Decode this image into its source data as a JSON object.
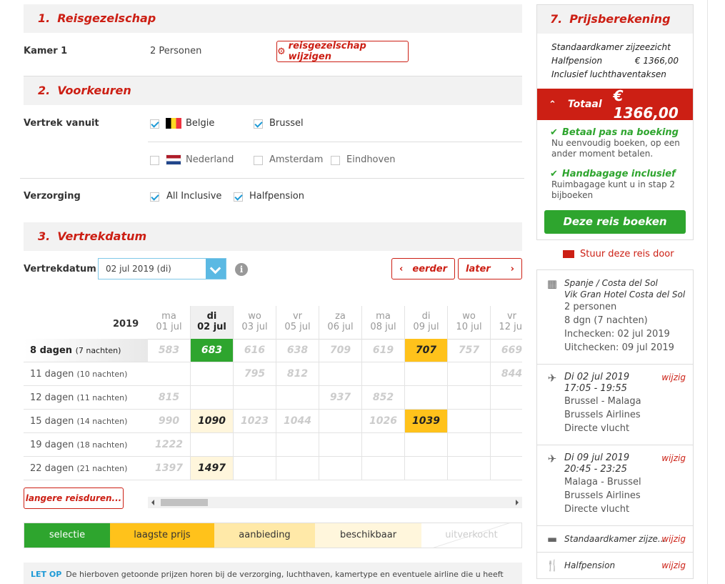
{
  "section1": {
    "num": "1.",
    "title": "Reisgezelschap",
    "kamer_label": "Kamer 1",
    "personen": "2 Personen",
    "wijzigen_button": "reisgezelschap wijzigen"
  },
  "section2": {
    "num": "2.",
    "title": "Voorkeuren",
    "vertrek_label": "Vertrek vanuit",
    "countries": [
      {
        "name": "Belgie",
        "checked": true
      },
      {
        "name": "Nederland",
        "checked": false
      }
    ],
    "airports": [
      {
        "name": "Brussel",
        "checked": true
      },
      {
        "name": "Amsterdam",
        "checked": false
      },
      {
        "name": "Eindhoven",
        "checked": false
      }
    ],
    "verzorging_label": "Verzorging",
    "verzorging": [
      {
        "name": "All Inclusive",
        "checked": true
      },
      {
        "name": "Halfpension",
        "checked": true
      }
    ]
  },
  "section3": {
    "num": "3.",
    "title": "Vertrekdatum",
    "date_label": "Vertrekdatum",
    "selected_date": "02 jul 2019 (di)",
    "earlier_button": "eerder",
    "later_button": "later",
    "year": "2019",
    "columns": [
      {
        "day": "ma",
        "date": "01 jul"
      },
      {
        "day": "di",
        "date": "02 jul",
        "active": true
      },
      {
        "day": "wo",
        "date": "03 jul"
      },
      {
        "day": "vr",
        "date": "05 jul"
      },
      {
        "day": "za",
        "date": "06 jul"
      },
      {
        "day": "ma",
        "date": "08 jul"
      },
      {
        "day": "di",
        "date": "09 jul"
      },
      {
        "day": "wo",
        "date": "10 jul"
      },
      {
        "day": "vr",
        "date": "12 jul"
      }
    ],
    "rows": [
      {
        "label": "8 dagen",
        "nights": "(7 nachten)",
        "active": true,
        "cells": [
          [
            "583",
            ""
          ],
          [
            "683",
            "sel"
          ],
          [
            "616",
            ""
          ],
          [
            "638",
            ""
          ],
          [
            "709",
            ""
          ],
          [
            "619",
            ""
          ],
          [
            "707",
            "low"
          ],
          [
            "757",
            ""
          ],
          [
            "669",
            ""
          ]
        ]
      },
      {
        "label": "11 dagen",
        "nights": "(10 nachten)",
        "cells": [
          [
            "",
            ""
          ],
          [
            "",
            ""
          ],
          [
            "795",
            ""
          ],
          [
            "812",
            ""
          ],
          [
            "",
            ""
          ],
          [
            "",
            ""
          ],
          [
            "",
            ""
          ],
          [
            "",
            ""
          ],
          [
            "844",
            ""
          ]
        ]
      },
      {
        "label": "12 dagen",
        "nights": "(11 nachten)",
        "cells": [
          [
            "815",
            ""
          ],
          [
            "",
            ""
          ],
          [
            "",
            ""
          ],
          [
            "",
            ""
          ],
          [
            "937",
            ""
          ],
          [
            "852",
            ""
          ],
          [
            "",
            ""
          ],
          [
            "",
            ""
          ],
          [
            "",
            ""
          ]
        ]
      },
      {
        "label": "15 dagen",
        "nights": "(14 nachten)",
        "cells": [
          [
            "990",
            ""
          ],
          [
            "1090",
            "avail"
          ],
          [
            "1023",
            ""
          ],
          [
            "1044",
            ""
          ],
          [
            "",
            ""
          ],
          [
            "1026",
            ""
          ],
          [
            "1039",
            "low"
          ],
          [
            "",
            ""
          ],
          [
            "",
            ""
          ]
        ]
      },
      {
        "label": "19 dagen",
        "nights": "(18 nachten)",
        "cells": [
          [
            "1222",
            ""
          ],
          [
            "",
            ""
          ],
          [
            "",
            ""
          ],
          [
            "",
            ""
          ],
          [
            "",
            ""
          ],
          [
            "",
            ""
          ],
          [
            "",
            ""
          ],
          [
            "",
            ""
          ],
          [
            "",
            ""
          ]
        ]
      },
      {
        "label": "22 dagen",
        "nights": "(21 nachten)",
        "cells": [
          [
            "1397",
            ""
          ],
          [
            "1497",
            "avail"
          ],
          [
            "",
            ""
          ],
          [
            "",
            ""
          ],
          [
            "",
            ""
          ],
          [
            "",
            ""
          ],
          [
            "",
            ""
          ],
          [
            "",
            ""
          ],
          [
            "",
            ""
          ]
        ]
      }
    ],
    "longer_button": "langere reisduren...",
    "legend": [
      "selectie",
      "laagste prijs",
      "aanbieding",
      "beschikbaar",
      "uitverkocht"
    ],
    "note_label": "LET OP",
    "note_text": "De hierboven getoonde prijzen horen bij de verzorging, luchthaven, kamertype en eventuele airline die u heeft"
  },
  "price": {
    "num": "7.",
    "title": "Prijsberekening",
    "room": "Standaardkamer zijzeezicht",
    "board": "Halfpension",
    "board_price": "€ 1366,00",
    "tax_note": "Inclusief luchthaventaksen",
    "total_label": "Totaal",
    "total_value": "€ 1366,00",
    "usp1_title": "Betaal pas na boeking",
    "usp1_text": "Nu eenvoudig boeken, op een ander moment betalen.",
    "usp2_title": "Handbagage inclusief",
    "usp2_text": "Ruimbagage kunt u in stap 2 bijboeken",
    "book_button": "Deze reis boeken",
    "send_link": "Stuur deze reis door"
  },
  "summary": {
    "destination": "Spanje / Costa del Sol",
    "hotel": "Vik Gran Hotel Costa del Sol",
    "persons": "2 personen",
    "duration": "8 dgn (7 nachten)",
    "checkin": "Inchecken: 02 jul 2019",
    "checkout": "Uitchecken: 09 jul 2019",
    "wijzig": "wijzig",
    "outbound": {
      "date": "Di 02 jul 2019",
      "time": "17:05 - 19:55",
      "route": "Brussel - Malaga",
      "airline": "Brussels Airlines",
      "type": "Directe vlucht"
    },
    "inbound": {
      "date": "Di 09 jul 2019",
      "time": "20:45 - 23:25",
      "route": "Malaga - Brussel",
      "airline": "Brussels Airlines",
      "type": "Directe vlucht"
    },
    "room": "Standaardkamer zijze...",
    "board": "Halfpension"
  },
  "colors": {
    "brand_red": "#cc1f14",
    "green": "#2ea52e",
    "lowest": "#ffc21b",
    "offer": "#ffe9a8",
    "available": "#fff6dc",
    "accent_blue": "#1e9ad6"
  }
}
